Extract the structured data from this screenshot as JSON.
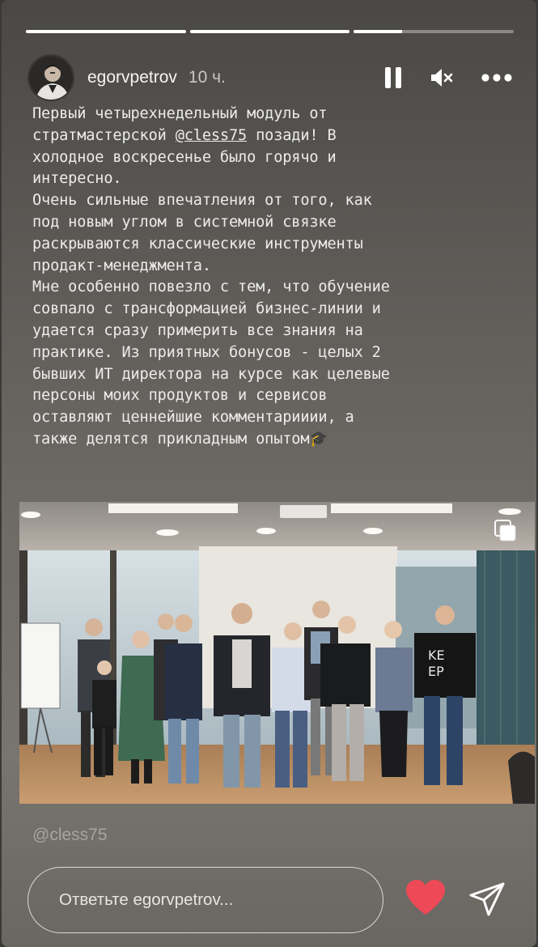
{
  "progress": [
    {
      "name": "story-segment-1",
      "fill": 1.0
    },
    {
      "name": "story-segment-2",
      "fill": 1.0
    },
    {
      "name": "story-segment-3",
      "fill": 0.3
    }
  ],
  "header": {
    "username": "egorvpetrov",
    "time": "10 ч."
  },
  "icons": {
    "pause": "pause-icon",
    "mute": "volume-muted-icon",
    "more": "more-icon",
    "gallery": "multiple-images-icon",
    "like": "heart-icon",
    "share": "send-icon"
  },
  "caption": {
    "line1": "Первый четырехнедельный модуль от",
    "line2_a": "стратмастерской ",
    "mention": "@cless75",
    "line2_b": " позади! В",
    "rest": "холодное воскресенье было горячо и\nинтересно.\nОчень сильные впечатления от того, как\nпод новым углом в системной связке\nраскрываются классические инструменты\nпродакт-менеджмента.\nМне особенно повезло с тем, что обучение\nсовпало с трансформацией бизнес-линии и\nудается сразу примерить все знания на\nпрактике. Из приятных бонусов - целых 2\nбывших ИТ директора на курсе как целевые\nперсоны моих продуктов и сервисов\nоставляют ценнейшие комментарииии, а\nтакже делятся прикладным опытом",
    "emoji": "🎓"
  },
  "mention_sticker": "@cless75",
  "reply": {
    "placeholder": "Ответьте egorvpetrov..."
  },
  "colors": {
    "like": "#ed4956",
    "text": "#ececec"
  }
}
